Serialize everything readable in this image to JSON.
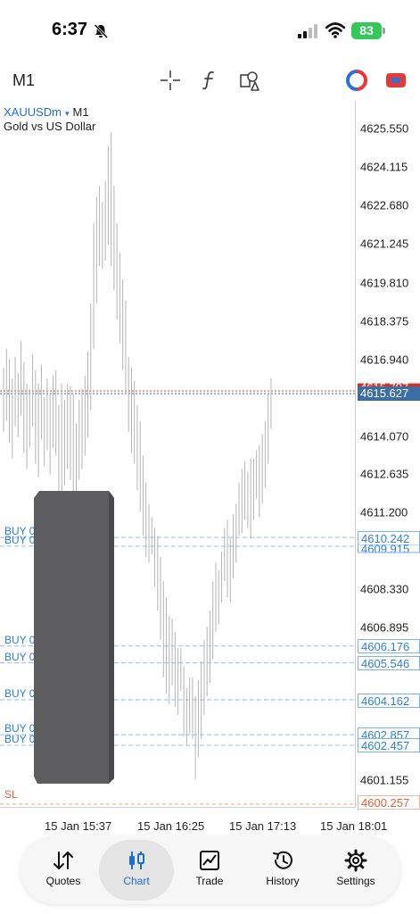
{
  "status_bar": {
    "time": "6:37",
    "battery": "83"
  },
  "toolbar": {
    "timeframe": "M1"
  },
  "chart_header": {
    "symbol": "XAUUSDm",
    "arrow": "▾",
    "timeframe": "M1",
    "description": "Gold vs US Dollar"
  },
  "price_axis": {
    "ticks": [
      "4625.550",
      "4624.115",
      "4622.680",
      "4621.245",
      "4619.810",
      "4618.375",
      "4616.940",
      "4614.070",
      "4612.635",
      "4611.200",
      "4608.330",
      "4606.895",
      "4601.155"
    ],
    "current_price": "4615.627",
    "bid_tag_partial": "4615.797"
  },
  "orders": [
    {
      "label": "BUY 0",
      "price": "4610.242"
    },
    {
      "label": "BUY 0",
      "price": "4609.915"
    },
    {
      "label": "BUY 0",
      "price": "4606.176"
    },
    {
      "label": "BUY 0",
      "price": "4605.546"
    },
    {
      "label": "BUY 0",
      "price": "4604.162"
    },
    {
      "label": "BUY 0",
      "price": "4602.857"
    },
    {
      "label": "BUY 0",
      "price": "4602.457"
    }
  ],
  "stop_loss": {
    "label": "SL",
    "price": "4600.257"
  },
  "time_axis": {
    "labels": [
      "15 Jan 15:37",
      "15 Jan 16:25",
      "15 Jan 17:13",
      "15 Jan 18:01"
    ]
  },
  "chart_data": {
    "type": "bar",
    "symbol": "XAUUSDm",
    "timeframe": "M1",
    "y_range": [
      4600.0,
      4626.3
    ],
    "bars": [
      [
        4616.6,
        4614.2
      ],
      [
        4617.3,
        4614.6
      ],
      [
        4616.9,
        4613.8
      ],
      [
        4616.2,
        4613.2
      ],
      [
        4617.0,
        4614.4
      ],
      [
        4616.4,
        4614.0
      ],
      [
        4617.6,
        4614.8
      ],
      [
        4616.8,
        4613.4
      ],
      [
        4616.0,
        4612.8
      ],
      [
        4615.8,
        4613.6
      ],
      [
        4617.1,
        4614.4
      ],
      [
        4616.5,
        4613.0
      ],
      [
        4616.0,
        4612.5
      ],
      [
        4616.7,
        4613.9
      ],
      [
        4615.5,
        4612.9
      ],
      [
        4616.2,
        4613.5
      ],
      [
        4615.6,
        4612.6
      ],
      [
        4616.3,
        4613.6
      ],
      [
        4616.5,
        4613.3
      ],
      [
        4615.2,
        4611.5
      ],
      [
        4616.0,
        4611.2
      ],
      [
        4615.4,
        4612.2
      ],
      [
        4616.0,
        4612.8
      ],
      [
        4615.9,
        4612.4
      ],
      [
        4615.6,
        4611.8
      ],
      [
        4614.5,
        4611.5
      ],
      [
        4615.4,
        4612.4
      ],
      [
        4615.8,
        4612.8
      ],
      [
        4616.3,
        4613.3
      ],
      [
        4617.2,
        4614.0
      ],
      [
        4619.0,
        4615.0
      ],
      [
        4622.0,
        4617.3
      ],
      [
        4623.0,
        4619.0
      ],
      [
        4623.4,
        4620.4
      ],
      [
        4622.8,
        4620.3
      ],
      [
        4623.6,
        4620.6
      ],
      [
        4624.9,
        4621.2
      ],
      [
        4625.4,
        4620.4
      ],
      [
        4623.4,
        4619.5
      ],
      [
        4622.0,
        4618.4
      ],
      [
        4620.9,
        4617.5
      ],
      [
        4619.9,
        4616.5
      ],
      [
        4619.1,
        4615.6
      ],
      [
        4617.0,
        4614.2
      ],
      [
        4616.6,
        4613.4
      ],
      [
        4616.1,
        4613.0
      ],
      [
        4615.2,
        4612.0
      ],
      [
        4614.6,
        4611.2
      ],
      [
        4613.3,
        4610.3
      ],
      [
        4612.3,
        4609.5
      ],
      [
        4611.5,
        4609.3
      ],
      [
        4611.0,
        4609.6
      ],
      [
        4610.6,
        4608.4
      ],
      [
        4610.3,
        4607.5
      ],
      [
        4609.5,
        4606.4
      ],
      [
        4608.6,
        4605.0
      ],
      [
        4608.0,
        4604.4
      ],
      [
        4607.3,
        4604.0
      ],
      [
        4607.2,
        4604.7
      ],
      [
        4606.7,
        4603.9
      ],
      [
        4606.1,
        4603.6
      ],
      [
        4606.1,
        4604.5
      ],
      [
        4605.4,
        4602.8
      ],
      [
        4604.6,
        4602.5
      ],
      [
        4605.0,
        4602.9
      ],
      [
        4605.0,
        4602.7
      ],
      [
        4604.3,
        4601.2
      ],
      [
        4604.9,
        4602.0
      ],
      [
        4605.6,
        4602.7
      ],
      [
        4606.4,
        4603.6
      ],
      [
        4606.9,
        4604.3
      ],
      [
        4607.5,
        4604.8
      ],
      [
        4608.6,
        4605.7
      ],
      [
        4609.3,
        4606.7
      ],
      [
        4609.0,
        4607.0
      ],
      [
        4609.7,
        4607.8
      ],
      [
        4610.6,
        4608.6
      ],
      [
        4610.9,
        4608.0
      ],
      [
        4610.2,
        4607.8
      ],
      [
        4611.1,
        4608.7
      ],
      [
        4611.5,
        4609.3
      ],
      [
        4612.3,
        4610.3
      ],
      [
        4612.8,
        4610.4
      ],
      [
        4613.1,
        4610.9
      ],
      [
        4612.7,
        4610.6
      ],
      [
        4613.2,
        4610.2
      ],
      [
        4613.2,
        4610.9
      ],
      [
        4613.5,
        4611.7
      ],
      [
        4613.7,
        4611.0
      ],
      [
        4614.1,
        4611.5
      ],
      [
        4614.6,
        4612.1
      ],
      [
        4615.6,
        4613.0
      ],
      [
        4616.2,
        4614.3
      ]
    ]
  },
  "tabs": [
    {
      "label": "Quotes"
    },
    {
      "label": "Chart"
    },
    {
      "label": "Trade"
    },
    {
      "label": "History"
    },
    {
      "label": "Settings"
    }
  ]
}
